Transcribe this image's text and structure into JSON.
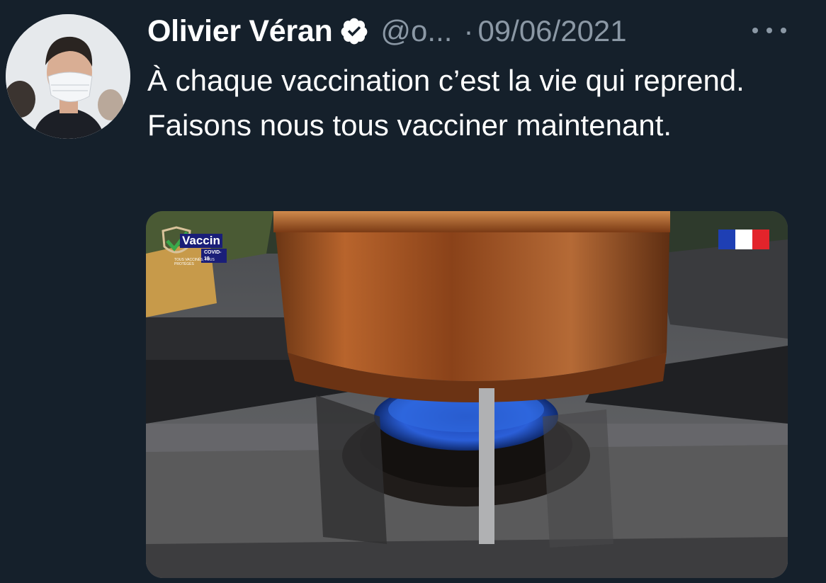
{
  "tweet": {
    "author_name": "Olivier Véran",
    "handle": "@o...",
    "separator": "·",
    "date": "09/06/2021",
    "text": "À chaque vaccination c’est la vie qui reprend. Faisons nous tous vacciner maintenant."
  },
  "media": {
    "logo_word": "Vaccin",
    "logo_sub": "COVID-19",
    "logo_tagline": "TOUS VACCINÉS, TOUS PROTÉGÉS"
  },
  "colors": {
    "background": "#15202b",
    "text": "#ffffff",
    "secondary": "#8b98a5",
    "verified_badge": "#ffffff"
  },
  "icons": {
    "verified": "verified-badge-icon",
    "more": "more-dots-icon"
  }
}
